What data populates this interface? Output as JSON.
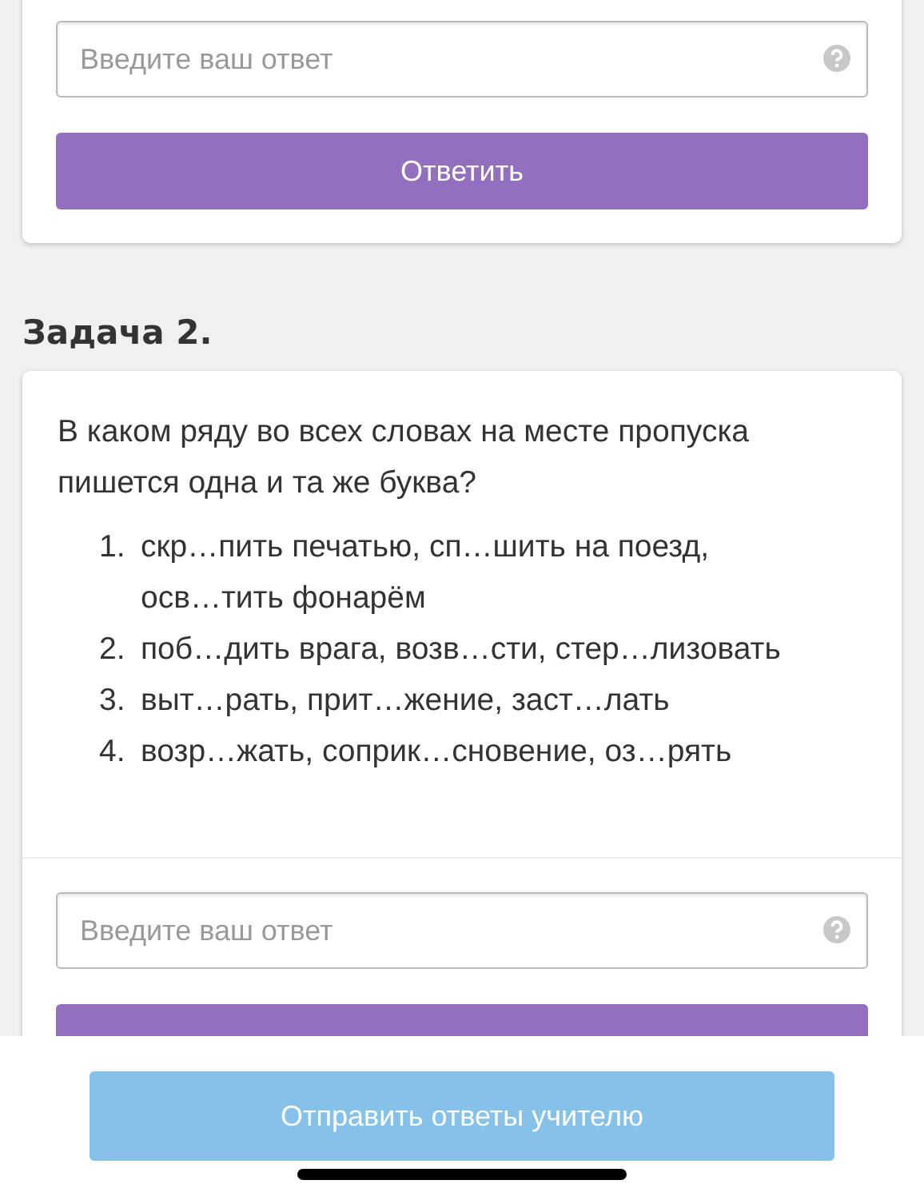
{
  "tasks": [
    {
      "answer_field": {
        "placeholder": "Введите ваш ответ"
      },
      "button": "Ответить"
    },
    {
      "title": "Задача 2.",
      "question": "В каком ряду во всех словах на месте пропуска пишется одна и та же буква?",
      "options": [
        {
          "number": "1.",
          "text": "скр…пить печатью, сп…шить на поезд, осв…тить фонарём"
        },
        {
          "number": "2.",
          "text": "поб…дить врага, возв…сти, стер…лизовать"
        },
        {
          "number": "3.",
          "text": "выт…рать, прит…жение, заст…лать"
        },
        {
          "number": "4.",
          "text": "возр…жать, соприк…сновение, оз…рять"
        }
      ],
      "answer_field": {
        "placeholder": "Введите ваш ответ"
      }
    }
  ],
  "submit_button": "Отправить ответы учителю"
}
